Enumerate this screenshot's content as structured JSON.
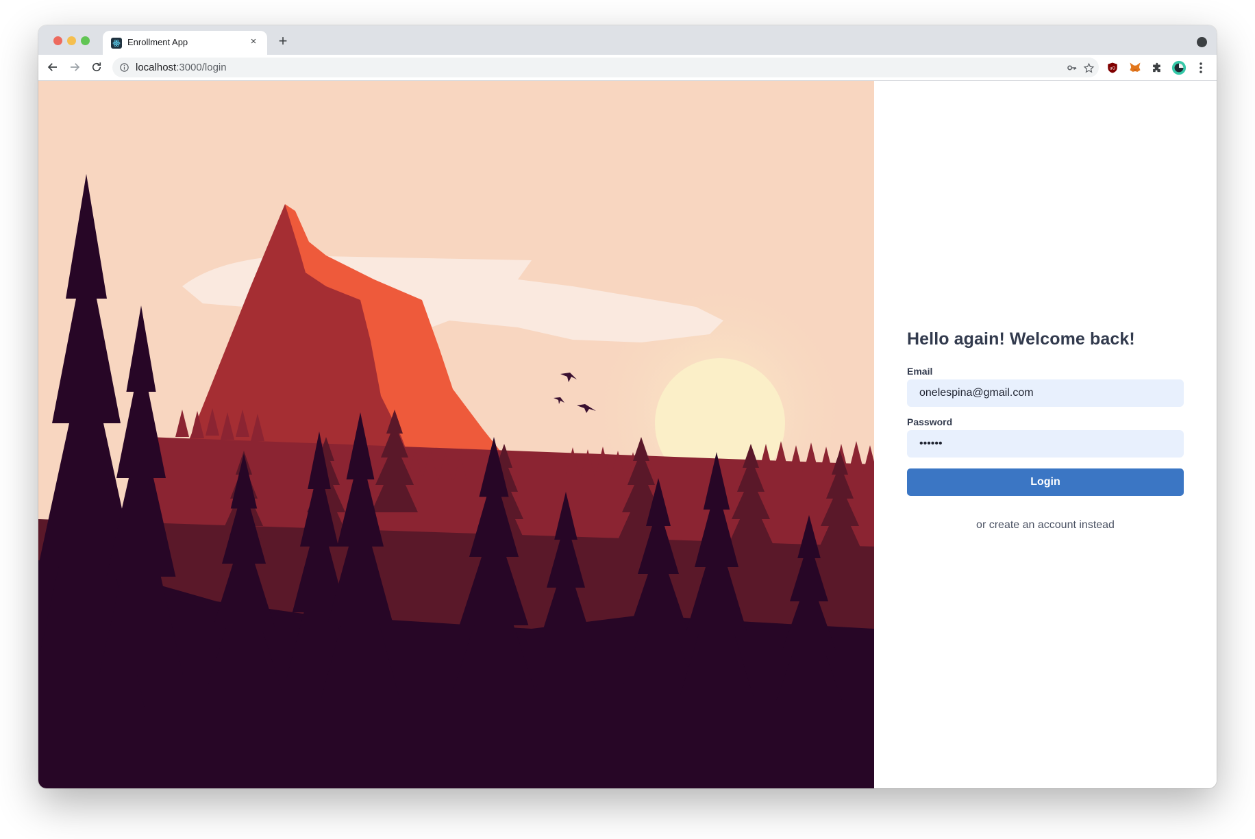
{
  "browser": {
    "tab_title": "Enrollment App",
    "tab_close_glyph": "×",
    "new_tab_glyph": "+",
    "url_host": "localhost",
    "url_path": ":3000/login",
    "traffic_lights": [
      "#ed6a5e",
      "#f5bf4f",
      "#61c554"
    ],
    "extension_icons": [
      "ublock-icon",
      "metamask-icon",
      "puzzle-extensions-icon",
      "profile-avatar-icon"
    ]
  },
  "illustration": {
    "description_icon": "sunset-mountain-forest-illustration",
    "colors": {
      "sky": "#f8d6c0",
      "cloud": "#fae9df",
      "sun": "#fbefc8",
      "mountain_shadow": "#a52e33",
      "mountain_light": "#ee5a3b",
      "far_trees": "#8b2432",
      "mid_trees": "#5a1829",
      "near_trees": "#270626"
    }
  },
  "login": {
    "heading": "Hello again! Welcome back!",
    "email_label": "Email",
    "email_value": "onelespina@gmail.com",
    "password_label": "Password",
    "password_value": "••••••",
    "login_button": "Login",
    "create_account_link": "or create an account instead"
  },
  "theme": {
    "input_bg": "#e8f0fd",
    "button_bg": "#3b76c4",
    "heading_color": "#323a4d"
  }
}
